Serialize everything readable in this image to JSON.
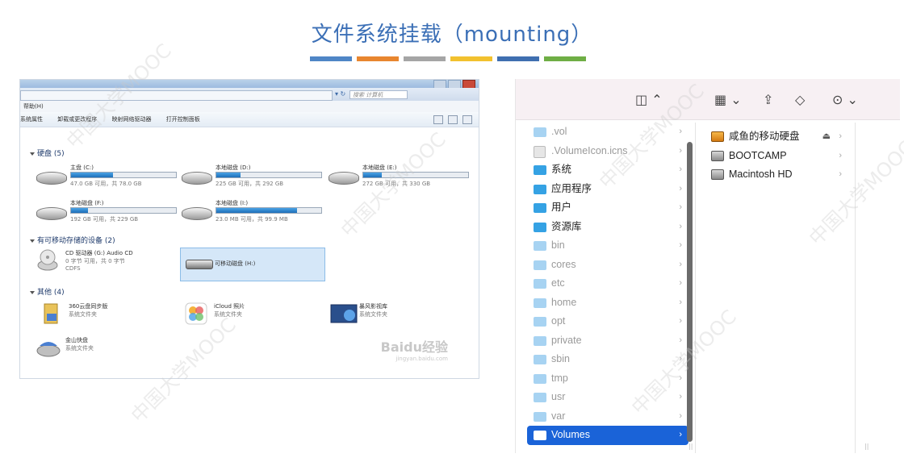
{
  "slide": {
    "title": "文件系统挂载（mounting）",
    "stripe_colors": [
      "#4f86c6",
      "#e8862f",
      "#a5a5a5",
      "#f2c12e",
      "#3f6fb0",
      "#6fae45"
    ]
  },
  "windows": {
    "search_placeholder": "搜索 计算机",
    "menu_help": "帮助(H)",
    "toolbar": [
      "系统属性",
      "卸载或更改程序",
      "映射网络驱动器",
      "打开控制面板"
    ],
    "groups": {
      "hdd": "硬盘 (5)",
      "removable": "有可移动存储的设备 (2)",
      "other": "其他 (4)"
    },
    "drives": [
      {
        "name": "主盘 (C:)",
        "free": "47.0 GB 可用，共 78.0 GB",
        "used_fraction": 0.4
      },
      {
        "name": "本地磁盘 (D:)",
        "free": "225 GB 可用，共 292 GB",
        "used_fraction": 0.23
      },
      {
        "name": "本地磁盘 (E:)",
        "free": "272 GB 可用，共 330 GB",
        "used_fraction": 0.18
      },
      {
        "name": "本地磁盘 (F:)",
        "free": "192 GB 可用，共 229 GB",
        "used_fraction": 0.16
      },
      {
        "name": "本地磁盘 (I:)",
        "free": "23.0 MB 可用，共 99.9 MB",
        "used_fraction": 0.77
      }
    ],
    "cd": {
      "name": "CD 驱动器 (G:) Audio CD",
      "line1": "0 字节 可用，共 0 字节",
      "line2": "CDFS"
    },
    "removable_disk": "可移动磁盘 (H:)",
    "others": [
      {
        "name": "360云盘同步版",
        "type": "系统文件夹"
      },
      {
        "name": "iCloud 照片",
        "type": "系统文件夹"
      },
      {
        "name": "暴风影视库",
        "type": "系统文件夹"
      },
      {
        "name": "金山快盘",
        "type": "系统文件夹"
      }
    ],
    "watermark": "Baidu经验",
    "watermark_sub": "jingyan.baidu.com"
  },
  "finder": {
    "col1": [
      {
        "label": ".vol",
        "kind": "folder",
        "dim": true
      },
      {
        "label": ".VolumeIcon.icns",
        "kind": "doc",
        "dim": true
      },
      {
        "label": "系统",
        "kind": "folder",
        "dim": false
      },
      {
        "label": "应用程序",
        "kind": "folder",
        "dim": false
      },
      {
        "label": "用户",
        "kind": "folder",
        "dim": false
      },
      {
        "label": "资源库",
        "kind": "folder",
        "dim": false
      },
      {
        "label": "bin",
        "kind": "folder",
        "dim": true
      },
      {
        "label": "cores",
        "kind": "folder",
        "dim": true
      },
      {
        "label": "etc",
        "kind": "alias",
        "dim": true
      },
      {
        "label": "home",
        "kind": "alias",
        "dim": true
      },
      {
        "label": "opt",
        "kind": "folder",
        "dim": true
      },
      {
        "label": "private",
        "kind": "folder",
        "dim": true
      },
      {
        "label": "sbin",
        "kind": "folder",
        "dim": true
      },
      {
        "label": "tmp",
        "kind": "alias",
        "dim": true
      },
      {
        "label": "usr",
        "kind": "folder",
        "dim": true
      },
      {
        "label": "var",
        "kind": "alias",
        "dim": true
      },
      {
        "label": "Volumes",
        "kind": "folder",
        "dim": false,
        "selected": true
      }
    ],
    "col2": [
      {
        "label": "咸鱼的移动硬盘",
        "kind": "usb",
        "eject": true
      },
      {
        "label": "BOOTCAMP",
        "kind": "disk",
        "eject": false
      },
      {
        "label": "Macintosh HD",
        "kind": "disk",
        "eject": false
      }
    ]
  },
  "watermark_text": "中国大学MOOC"
}
